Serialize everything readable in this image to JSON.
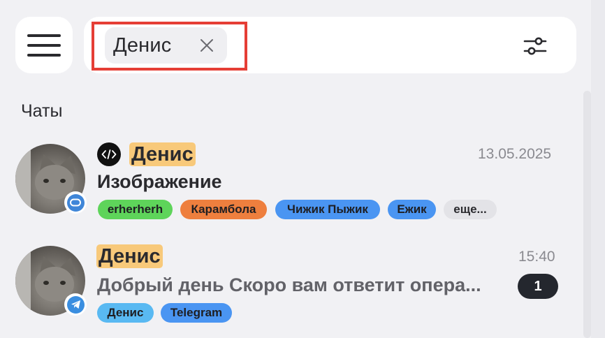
{
  "search": {
    "chip_label": "Денис"
  },
  "section": {
    "title": "Чаты"
  },
  "colors": {
    "highlight": "#f8c97a",
    "annotation_box": "#e53e35",
    "unread_badge": "#24272e"
  },
  "chats": [
    {
      "name": "Денис",
      "date": "13.05.2025",
      "message": "Изображение",
      "channel_icon": "chat-bubble-icon",
      "tags": [
        {
          "label": "erherherh",
          "color": "#5ed45a"
        },
        {
          "label": "Карамбола",
          "color": "#ee7f3e"
        },
        {
          "label": "Чижик Пыжик",
          "color": "#4a95f2"
        },
        {
          "label": "Ежик",
          "color": "#4a95f2"
        },
        {
          "label": "еще...",
          "color": "#e3e3e7"
        }
      ]
    },
    {
      "name": "Денис",
      "date": "15:40",
      "message": "Добрый день Скоро вам ответит опера...",
      "unread_count": "1",
      "channel_icon": "telegram-icon",
      "tags": [
        {
          "label": "Денис",
          "color": "#59b9f2"
        },
        {
          "label": "Telegram",
          "color": "#4a95f2"
        }
      ]
    }
  ]
}
